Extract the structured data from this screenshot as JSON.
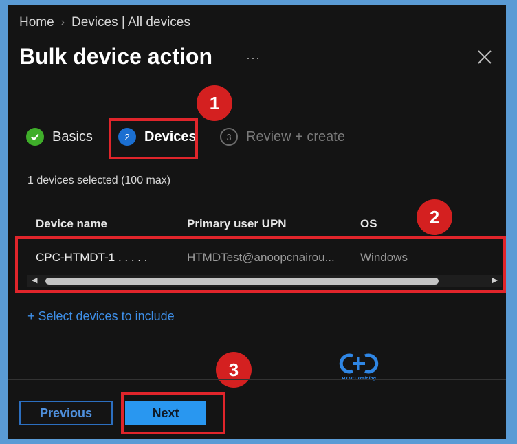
{
  "breadcrumb": {
    "home": "Home",
    "separator": "›",
    "devices": "Devices | All devices"
  },
  "page": {
    "title": "Bulk device action",
    "more": "···"
  },
  "steps": [
    {
      "number": "✓",
      "label": "Basics",
      "state": "done"
    },
    {
      "number": "2",
      "label": "Devices",
      "state": "active"
    },
    {
      "number": "3",
      "label": "Review + create",
      "state": "pending"
    }
  ],
  "callouts": {
    "c1": "1",
    "c2": "2",
    "c3": "3"
  },
  "selection": {
    "count_text": "1 devices selected (100 max)"
  },
  "table": {
    "columns": [
      "Device name",
      "Primary user UPN",
      "OS"
    ],
    "rows": [
      {
        "device": "CPC-HTMDT-1 . . . . .",
        "upn": "HTMDTest@anoopcnairou...",
        "os": "Windows"
      }
    ]
  },
  "scroll": {
    "left": "◀",
    "right": "▶"
  },
  "actions": {
    "add_devices": "+ Select devices to include",
    "previous": "Previous",
    "next": "Next"
  },
  "logo": {
    "caption": "HTMD Training"
  },
  "colors": {
    "accent": "#2997f0",
    "callout": "#d42020",
    "success": "#3fae2a",
    "background": "#141414"
  }
}
